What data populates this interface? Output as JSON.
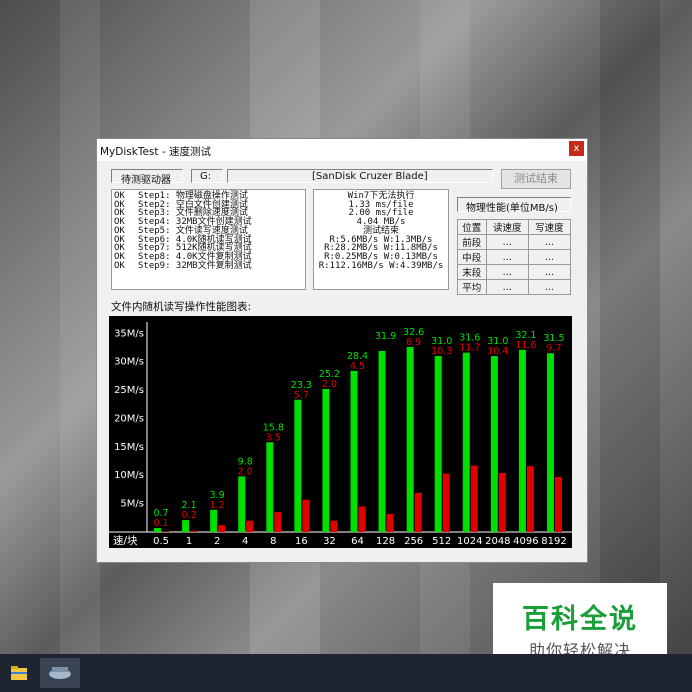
{
  "window": {
    "title": "MyDiskTest - 速度测试",
    "close_label": "x"
  },
  "drive": {
    "label": "待测驱动器",
    "letter": "G:",
    "name": "[SanDisk Cruzer Blade]",
    "finish_button": "测试结束"
  },
  "steps": [
    {
      "status": "OK",
      "text": "Step1: 物理磁盘操作测试"
    },
    {
      "status": "OK",
      "text": "Step2: 空白文件创建测试"
    },
    {
      "status": "OK",
      "text": "Step3: 文件删除速度测试"
    },
    {
      "status": "OK",
      "text": "Step4: 32MB文件创建测试"
    },
    {
      "status": "OK",
      "text": "Step5: 文件读写速度测试"
    },
    {
      "status": "OK",
      "text": "Step6: 4.0K随机读写测试"
    },
    {
      "status": "OK",
      "text": "Step7: 512K随机读写测试"
    },
    {
      "status": "OK",
      "text": "Step8: 4.0K文件复制测试"
    },
    {
      "status": "OK",
      "text": "Step9: 32MB文件复制测试"
    }
  ],
  "results": [
    "Win7下无法执行",
    "1.33 ms/file",
    "2.00 ms/file",
    "4.04 MB/s",
    "测试结束",
    "R:5.6MB/s W:1.3MB/s",
    "R:28.2MB/s W:11.8MB/s",
    "R:0.25MB/s W:0.13MB/s",
    "R:112.16MB/s W:4.39MB/s"
  ],
  "perf": {
    "title": "物理性能(单位MB/s)",
    "headers": [
      "位置",
      "读速度",
      "写速度"
    ],
    "rows": [
      {
        "pos": "前段",
        "read": "...",
        "write": "..."
      },
      {
        "pos": "中段",
        "read": "...",
        "write": "..."
      },
      {
        "pos": "末段",
        "read": "...",
        "write": "..."
      },
      {
        "pos": "平均",
        "read": "...",
        "write": "..."
      }
    ]
  },
  "chart_title": "文件内随机读写操作性能图表:",
  "chart_data": {
    "type": "bar",
    "title": "文件内随机读写操作性能图表:",
    "xlabel": "速/块",
    "ylabel": "",
    "ylim": [
      0,
      37
    ],
    "y_ticks": [
      "5M/s",
      "10M/s",
      "15M/s",
      "20M/s",
      "25M/s",
      "30M/s",
      "35M/s"
    ],
    "y_tick_values": [
      5,
      10,
      15,
      20,
      25,
      30,
      35
    ],
    "categories": [
      "0.5",
      "1",
      "2",
      "4",
      "8",
      "16",
      "32",
      "64",
      "128",
      "256",
      "512",
      "1024",
      "2048",
      "4096",
      "8192"
    ],
    "series": [
      {
        "color": "#00e000",
        "values": [
          0.7,
          2.1,
          3.9,
          9.8,
          15.8,
          23.3,
          25.2,
          28.4,
          31.9,
          32.6,
          31.0,
          31.6,
          31.0,
          32.1,
          31.5
        ],
        "labels": [
          "0.7",
          "2.1",
          "3.9",
          "9.8",
          "15.8",
          "23.3",
          "25.2",
          "28.4",
          "31.9",
          "32.6",
          "31.0",
          "31.6",
          "31.0",
          "32.1",
          "31.5"
        ]
      },
      {
        "color": "#e00000",
        "values": [
          0.1,
          0.2,
          1.2,
          2.0,
          3.5,
          5.7,
          2.0,
          4.5,
          3.2,
          6.9,
          10.3,
          11.7,
          10.4,
          11.6,
          9.7
        ],
        "labels": [
          "0.1",
          "0.2",
          "1.2",
          "2.0",
          "3.5",
          "5.7",
          "2.0",
          "4.5",
          "",
          "6.9",
          "10.3",
          "11.7",
          "10.4",
          "11.6",
          "9.7"
        ]
      }
    ],
    "grid": false,
    "legend": "none"
  },
  "watermark": {
    "title": "百科全说",
    "subtitle": "助你轻松解决"
  },
  "taskbar": {
    "icons": [
      "file-explorer-icon",
      "disk-test-app-icon"
    ]
  }
}
